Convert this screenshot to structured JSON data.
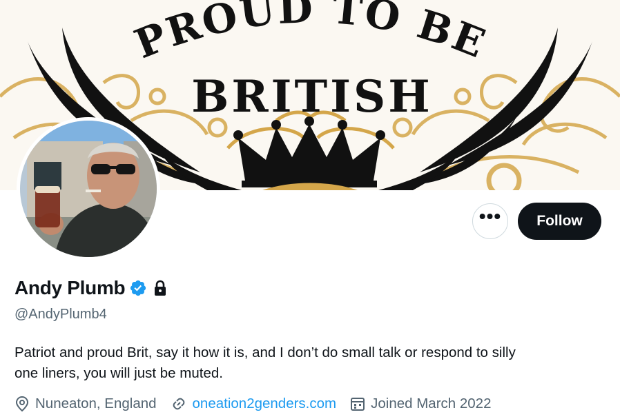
{
  "banner": {
    "line1": "PROUD TO BE",
    "line2": "BRITISH",
    "accent_gold": "#d4a64a",
    "ink": "#111111"
  },
  "profile": {
    "display_name": "Andy Plumb",
    "handle": "@AndyPlumb4",
    "verified_icon": "verified-badge-icon",
    "verified_color": "#1d9bf0",
    "protected_icon": "lock-icon",
    "bio_line1": "Patriot and proud Brit, say it how it is, and I don’t do small talk or respond to silly",
    "bio_line2": "one liners, you will just be muted."
  },
  "actions": {
    "more_label": "•••",
    "follow_label": "Follow"
  },
  "meta": {
    "location": "Nuneaton, England",
    "location_icon": "location-pin-icon",
    "website": "oneation2genders.com",
    "website_icon": "link-icon",
    "joined": "Joined March 2022",
    "joined_icon": "calendar-icon"
  }
}
